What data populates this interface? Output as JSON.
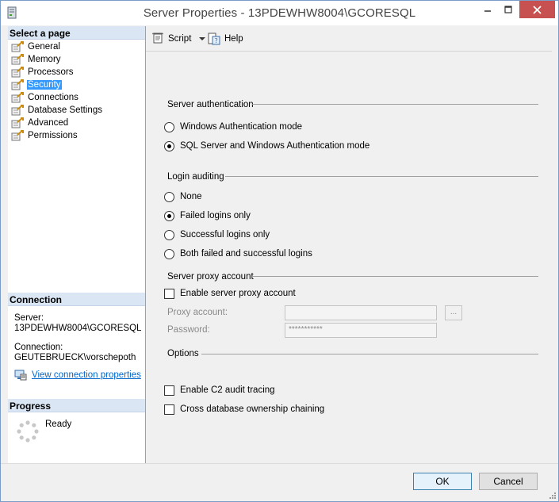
{
  "window": {
    "title": "Server Properties - 13PDEWHW8004\\GCORESQL"
  },
  "left": {
    "select_page_header": "Select a page",
    "pages": [
      {
        "label": "General"
      },
      {
        "label": "Memory"
      },
      {
        "label": "Processors"
      },
      {
        "label": "Security"
      },
      {
        "label": "Connections"
      },
      {
        "label": "Database Settings"
      },
      {
        "label": "Advanced"
      },
      {
        "label": "Permissions"
      }
    ],
    "selected_page": "Security",
    "connection_header": "Connection",
    "server_label": "Server:",
    "server_value": "13PDEWHW8004\\GCORESQL",
    "connection_label": "Connection:",
    "connection_value": "GEUTEBRUECK\\vorschepoth",
    "view_connection_link": "View connection properties",
    "progress_header": "Progress",
    "progress_status": "Ready"
  },
  "toolbar": {
    "script_label": "Script",
    "help_label": "Help"
  },
  "security": {
    "server_auth_title": "Server authentication",
    "auth_options": [
      {
        "label": "Windows Authentication mode",
        "checked": false
      },
      {
        "label": "SQL Server and Windows Authentication mode",
        "checked": true
      }
    ],
    "login_auditing_title": "Login auditing",
    "audit_options": [
      {
        "label": "None",
        "checked": false
      },
      {
        "label": "Failed logins only",
        "checked": true
      },
      {
        "label": "Successful logins only",
        "checked": false
      },
      {
        "label": "Both failed and successful logins",
        "checked": false
      }
    ],
    "proxy_title": "Server proxy account",
    "enable_proxy_label": "Enable server proxy account",
    "enable_proxy_checked": false,
    "proxy_account_label": "Proxy account:",
    "proxy_account_value": "",
    "browse_label": "...",
    "password_label": "Password:",
    "password_value": "***********",
    "options_title": "Options",
    "c2_audit_label": "Enable C2 audit tracing",
    "c2_audit_checked": false,
    "cross_db_label": "Cross database ownership chaining",
    "cross_db_checked": false
  },
  "buttons": {
    "ok_label": "OK",
    "cancel_label": "Cancel"
  },
  "colors": {
    "selected_highlight": "#3399ff",
    "section_header_bg": "#dbe6f4",
    "close_button": "#c75050",
    "link": "#0066cc"
  }
}
